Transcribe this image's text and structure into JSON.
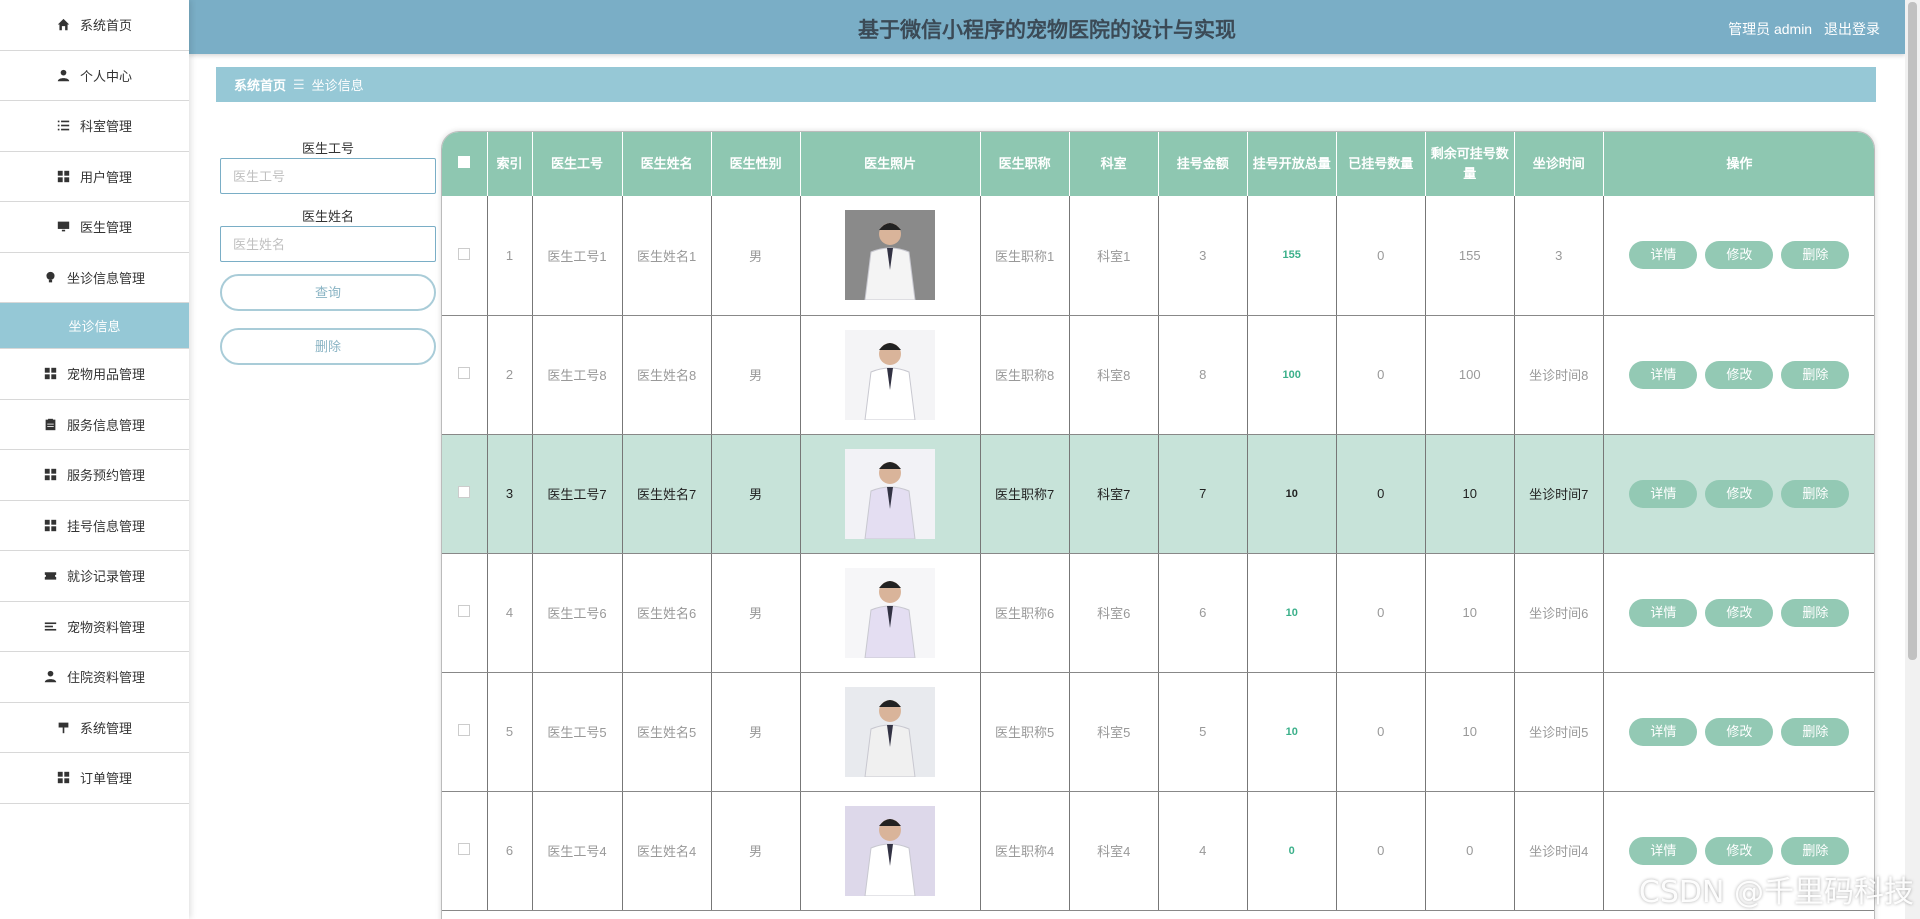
{
  "header": {
    "title": "基于微信小程序的宠物医院的设计与实现",
    "user": "管理员 admin",
    "logout": "退出登录"
  },
  "sidebar": {
    "items": [
      {
        "label": "系统首页",
        "icon": "home-icon"
      },
      {
        "label": "个人中心",
        "icon": "user-icon"
      },
      {
        "label": "科室管理",
        "icon": "list-icon"
      },
      {
        "label": "用户管理",
        "icon": "grid-icon"
      },
      {
        "label": "医生管理",
        "icon": "monitor-icon"
      },
      {
        "label": "坐诊信息管理",
        "icon": "bulb-icon"
      },
      {
        "label": "坐诊信息",
        "icon": "",
        "active": true
      },
      {
        "label": "宠物用品管理",
        "icon": "grid-icon"
      },
      {
        "label": "服务信息管理",
        "icon": "clipboard-icon"
      },
      {
        "label": "服务预约管理",
        "icon": "grid-icon"
      },
      {
        "label": "挂号信息管理",
        "icon": "grid-icon"
      },
      {
        "label": "就诊记录管理",
        "icon": "ticket-icon"
      },
      {
        "label": "宠物资料管理",
        "icon": "lines-icon"
      },
      {
        "label": "住院资料管理",
        "icon": "user-icon"
      },
      {
        "label": "系统管理",
        "icon": "pin-icon"
      },
      {
        "label": "订单管理",
        "icon": "grid-icon"
      }
    ]
  },
  "breadcrumb": {
    "home": "系统首页",
    "sep": "☰",
    "current": "坐诊信息"
  },
  "search": {
    "field1_label": "医生工号",
    "field1_placeholder": "医生工号",
    "field2_label": "医生姓名",
    "field2_placeholder": "医生姓名",
    "query_btn": "查询",
    "delete_btn": "删除"
  },
  "table": {
    "headers": [
      "索引",
      "医生工号",
      "医生姓名",
      "医生性别",
      "医生照片",
      "医生职称",
      "科室",
      "挂号金额",
      "挂号开放总量",
      "已挂号数量",
      "剩余可挂号数量",
      "坐诊时间",
      "操作"
    ],
    "action_labels": [
      "详情",
      "修改",
      "删除"
    ],
    "rows": [
      {
        "index": "1",
        "id": "医生工号1",
        "name": "医生姓名1",
        "gender": "男",
        "title": "医生职称1",
        "dept": "科室1",
        "fee": "3",
        "total": "155",
        "booked": "0",
        "remain": "155",
        "time": "3"
      },
      {
        "index": "2",
        "id": "医生工号8",
        "name": "医生姓名8",
        "gender": "男",
        "title": "医生职称8",
        "dept": "科室8",
        "fee": "8",
        "total": "100",
        "booked": "0",
        "remain": "100",
        "time": "坐诊时间8"
      },
      {
        "index": "3",
        "id": "医生工号7",
        "name": "医生姓名7",
        "gender": "男",
        "title": "医生职称7",
        "dept": "科室7",
        "fee": "7",
        "total": "10",
        "booked": "0",
        "remain": "10",
        "time": "坐诊时间7",
        "highlight": true
      },
      {
        "index": "4",
        "id": "医生工号6",
        "name": "医生姓名6",
        "gender": "男",
        "title": "医生职称6",
        "dept": "科室6",
        "fee": "6",
        "total": "10",
        "booked": "0",
        "remain": "10",
        "time": "坐诊时间6"
      },
      {
        "index": "5",
        "id": "医生工号5",
        "name": "医生姓名5",
        "gender": "男",
        "title": "医生职称5",
        "dept": "科室5",
        "fee": "5",
        "total": "10",
        "booked": "0",
        "remain": "10",
        "time": "坐诊时间5"
      },
      {
        "index": "6",
        "id": "医生工号4",
        "name": "医生姓名4",
        "gender": "男",
        "title": "医生职称4",
        "dept": "科室4",
        "fee": "4",
        "total": "0",
        "booked": "0",
        "remain": "0",
        "time": "坐诊时间4"
      }
    ]
  },
  "watermark": "CSDN @千里码科技",
  "colors": {
    "header": "#7aaec6",
    "breadcrumb": "#96c8d6",
    "table_head": "#8ec7b1",
    "action_btn": "#93c9b4",
    "highlight_row": "#c7e3d9"
  }
}
